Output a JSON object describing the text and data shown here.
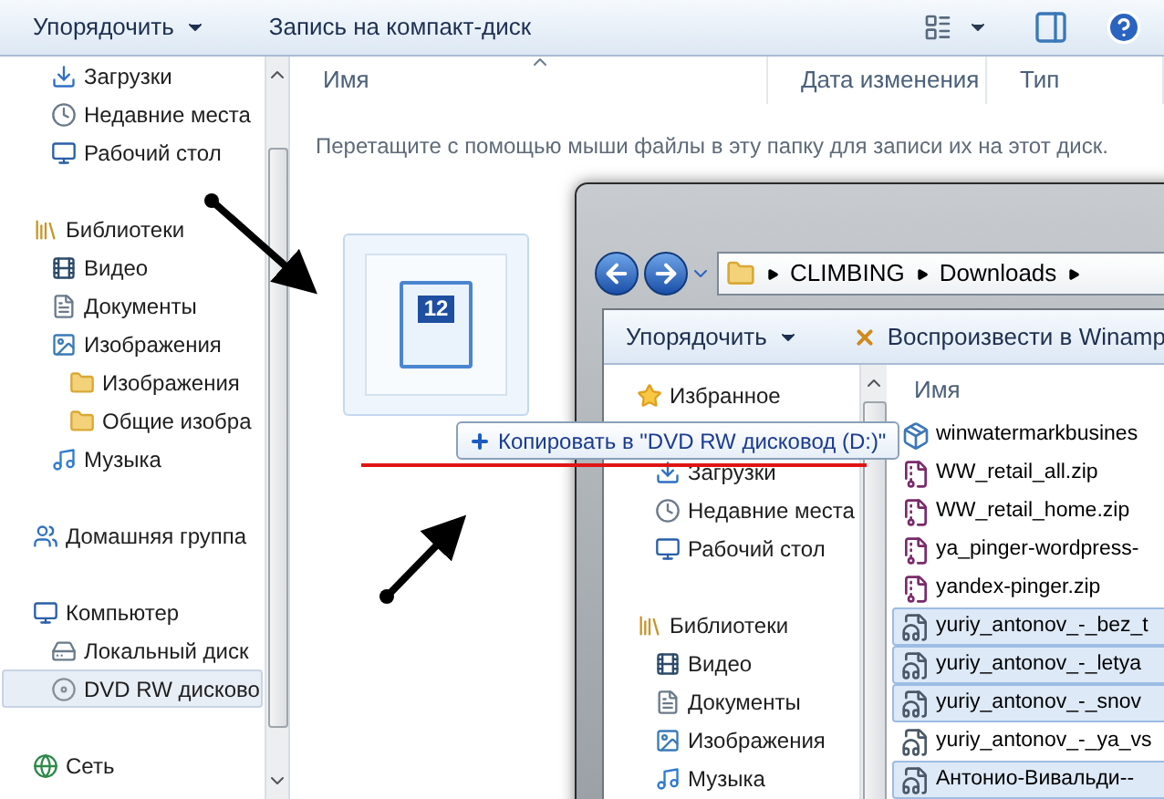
{
  "main_window": {
    "toolbar": {
      "organize": "Упорядочить",
      "burn": "Запись на компакт-диск"
    },
    "nav": [
      {
        "children": [
          {
            "label": "Загрузки",
            "kind": "downloads",
            "selected": false
          },
          {
            "label": "Недавние места",
            "kind": "recent",
            "selected": false
          },
          {
            "label": "Рабочий стол",
            "kind": "desktop",
            "selected": false
          }
        ]
      },
      {
        "label": "Библиотеки",
        "kind": "library",
        "selected": false,
        "children": [
          {
            "label": "Видео",
            "kind": "video",
            "selected": false
          },
          {
            "label": "Документы",
            "kind": "documents",
            "selected": false
          },
          {
            "label": "Изображения",
            "kind": "pictures",
            "selected": false,
            "children": [
              {
                "label": "Изображения",
                "kind": "folder",
                "selected": false
              },
              {
                "label": "Общие изобра",
                "kind": "folder",
                "selected": false
              }
            ]
          },
          {
            "label": "Музыка",
            "kind": "music",
            "selected": false
          }
        ]
      },
      {
        "label": "Домашняя группа",
        "kind": "homegroup",
        "selected": false
      },
      {
        "label": "Компьютер",
        "kind": "computer",
        "selected": false,
        "children": [
          {
            "label": "Локальный диск",
            "kind": "drive",
            "selected": false
          },
          {
            "label": "DVD RW дисково",
            "kind": "dvd",
            "selected": true
          }
        ]
      },
      {
        "label": "Сеть",
        "kind": "network",
        "selected": false
      }
    ],
    "columns": [
      {
        "label": "Имя",
        "sorted": true
      },
      {
        "label": "Дата изменения",
        "sorted": false
      },
      {
        "label": "Тип",
        "sorted": false
      }
    ],
    "empty_message": "Перетащите с помощью мыши файлы в эту папку для записи их на этот диск."
  },
  "drag": {
    "count": "12",
    "tooltip": "Копировать в \"DVD RW дисковод (D:)\""
  },
  "second_window": {
    "breadcrumb": [
      "CLIMBING",
      "Downloads"
    ],
    "toolbar": {
      "organize": "Упорядочить",
      "play": "Воспроизвести в Winamp"
    },
    "nav": [
      {
        "label": "Избранное",
        "kind": "favorites",
        "selected": false,
        "children": [
          {
            "label": "Загрузки",
            "kind": "downloads",
            "selected": false
          },
          {
            "label": "Недавние места",
            "kind": "recent",
            "selected": false
          },
          {
            "label": "Рабочий стол",
            "kind": "desktop",
            "selected": false
          }
        ]
      },
      {
        "label": "Библиотеки",
        "kind": "library",
        "selected": false,
        "children": [
          {
            "label": "Видео",
            "kind": "video",
            "selected": false
          },
          {
            "label": "Документы",
            "kind": "documents",
            "selected": false
          },
          {
            "label": "Изображения",
            "kind": "pictures",
            "selected": false
          },
          {
            "label": "Музыка",
            "kind": "music",
            "selected": false
          }
        ]
      }
    ],
    "column": "Имя",
    "files": [
      {
        "name": "winwatermarkbusines",
        "kind": "installer",
        "selected": false
      },
      {
        "name": "WW_retail_all.zip",
        "kind": "archive",
        "selected": false
      },
      {
        "name": "WW_retail_home.zip",
        "kind": "archive",
        "selected": false
      },
      {
        "name": "ya_pinger-wordpress-",
        "kind": "archive",
        "selected": false
      },
      {
        "name": "yandex-pinger.zip",
        "kind": "archive",
        "selected": false
      },
      {
        "name": "yuriy_antonov_-_bez_t",
        "kind": "audio",
        "selected": true
      },
      {
        "name": "yuriy_antonov_-_letya",
        "kind": "audio",
        "selected": true
      },
      {
        "name": "yuriy_antonov_-_snov",
        "kind": "audio",
        "selected": true
      },
      {
        "name": "yuriy_antonov_-_ya_vs",
        "kind": "audio",
        "selected": false
      },
      {
        "name": "Антонио-Вивальди--",
        "kind": "audio",
        "selected": true
      }
    ]
  }
}
